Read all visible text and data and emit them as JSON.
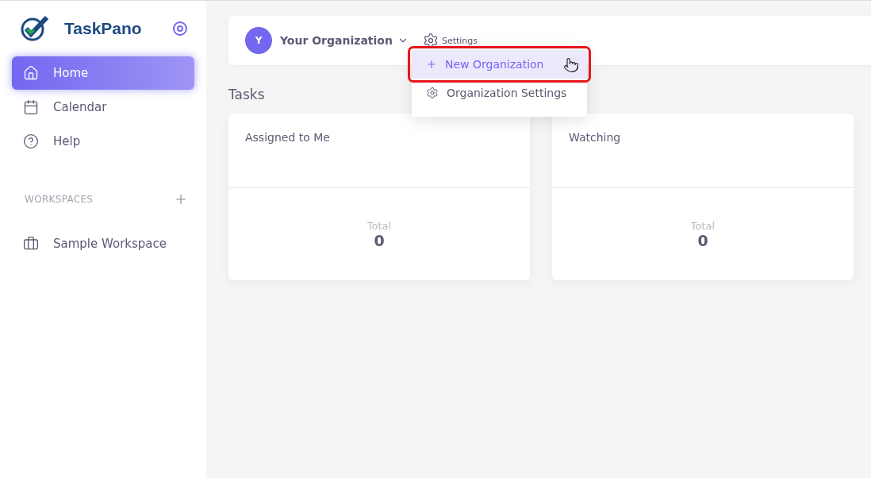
{
  "brand": {
    "name": "TaskPano"
  },
  "nav": [
    {
      "label": "Home",
      "kind": "home",
      "selected": true
    },
    {
      "label": "Calendar",
      "kind": "calendar",
      "selected": false
    },
    {
      "label": "Help",
      "kind": "help",
      "selected": false
    }
  ],
  "workspaces": {
    "heading": "WORKSPACES",
    "items": [
      {
        "label": "Sample Workspace",
        "kind": "workspace"
      }
    ]
  },
  "header": {
    "avatar": "Y",
    "organization": "Your Organization",
    "settings": "Settings"
  },
  "dropdown": [
    {
      "label": "New Organization",
      "kind": "add",
      "selected": true,
      "highlighted": true
    },
    {
      "label": "Organization Settings",
      "kind": "settings",
      "selected": false,
      "highlighted": false
    }
  ],
  "section_title": "Tasks",
  "cards": [
    {
      "title": "Assigned to Me",
      "total_label": "Total",
      "total": "0"
    },
    {
      "title": "Watching",
      "total_label": "Total",
      "total": "0"
    }
  ]
}
